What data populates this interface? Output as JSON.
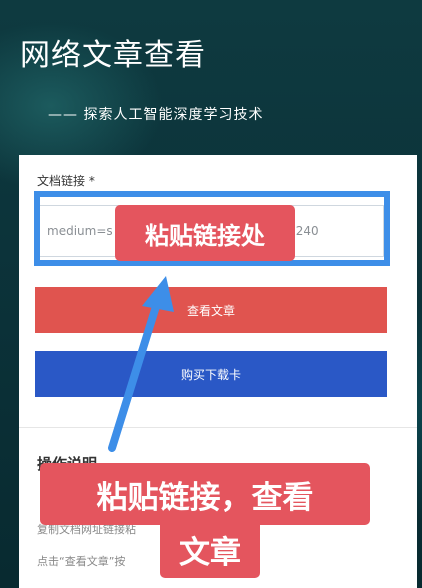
{
  "header": {
    "title": "网络文章查看",
    "subtitle": "—— 探索人工智能深度学习技术"
  },
  "form": {
    "url_label": "文档链接 *",
    "url_value": "medium=s                                    151690240"
  },
  "buttons": {
    "view": "查看文章",
    "buy": "购买下载卡"
  },
  "instructions": {
    "title": "操作说明",
    "line1": "复制文档网址链接粘",
    "line2": "点击“查看文章”按"
  },
  "annotations": {
    "top": "粘贴链接处",
    "bottom_line1": "粘贴链接，查看",
    "bottom_line2": "文章"
  },
  "colors": {
    "accent_red": "#e0544f",
    "accent_blue": "#2a58c6",
    "frame_blue": "#3d8ee8",
    "callout_red": "#e4555e"
  }
}
